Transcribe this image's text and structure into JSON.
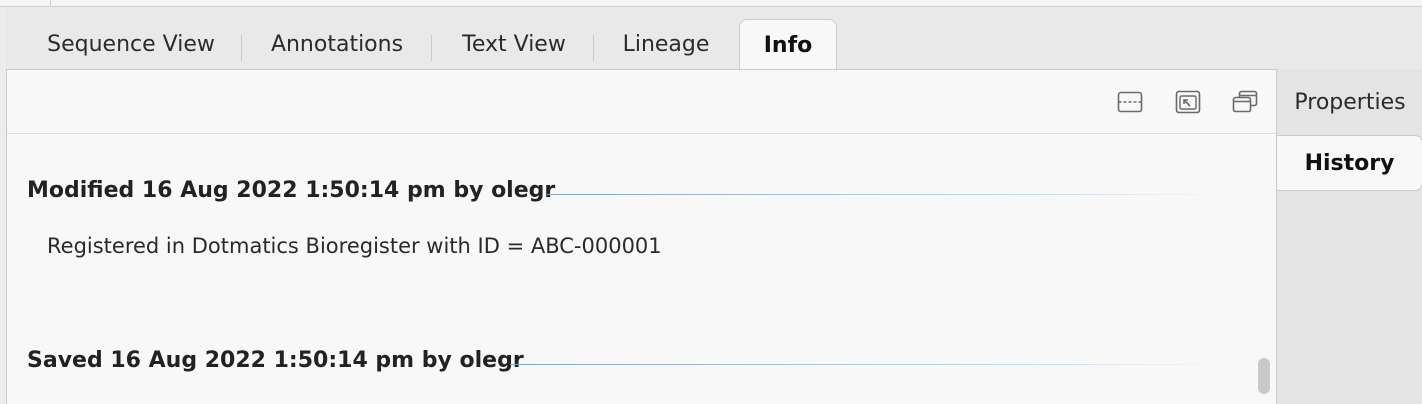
{
  "tabs": [
    {
      "label": "Sequence View",
      "active": false
    },
    {
      "label": "Annotations",
      "active": false
    },
    {
      "label": "Text View",
      "active": false
    },
    {
      "label": "Lineage",
      "active": false
    },
    {
      "label": "Info",
      "active": true
    }
  ],
  "toolbar": {
    "icons": [
      "collapse-icon",
      "expand-to-window-icon",
      "new-window-icon"
    ]
  },
  "side_tabs": [
    {
      "label": "Properties",
      "active": false
    },
    {
      "label": "History",
      "active": true
    }
  ],
  "history": [
    {
      "header": "Modified 16 Aug 2022 1:50:14 pm by olegr",
      "body": "Registered in Dotmatics Bioregister with ID =  ABC-000001"
    },
    {
      "header": "Saved 16 Aug 2022 1:50:14 pm by olegr",
      "body": ""
    }
  ],
  "colors": {
    "accent_line": "#7fa6c8",
    "panel_bg": "#f8f8f8",
    "chrome_bg": "#e9e9e9"
  }
}
